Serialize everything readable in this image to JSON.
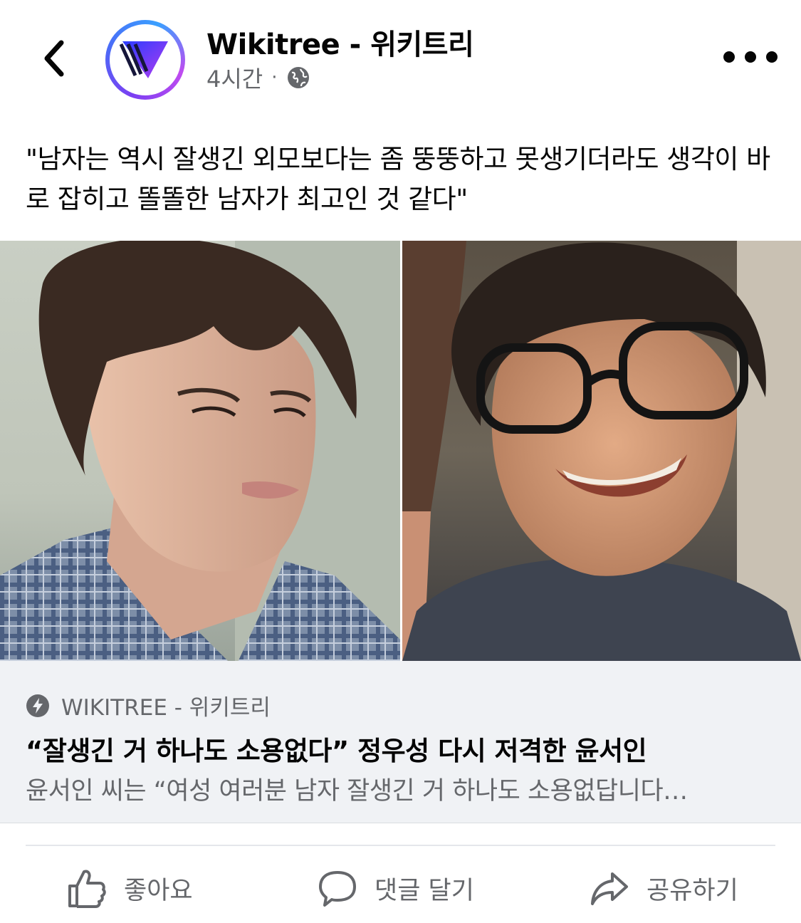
{
  "header": {
    "page_name": "Wikitree - 위키트리",
    "time": "4시간",
    "separator": "·",
    "icons": {
      "back": "chevron-left-icon",
      "privacy": "globe-icon",
      "more": "more-dots-icon"
    }
  },
  "post": {
    "caption": "\"남자는 역시 잘생긴 외모보다는 좀 뚱뚱하고 못생기더라도 생각이 바로 잡히고 똘똘한 남자가 최고인 것 같다\""
  },
  "link_card": {
    "source": "WIKITREE - 위키트리",
    "title": "“잘생긴 거 하나도 소용없다” 정우성 다시 저격한 윤서인",
    "description": "윤서인 씨는 “여성 여러분 남자 잘생긴 거 하나도 소용없답니다…"
  },
  "actions": {
    "like_label": "좋아요",
    "comment_label": "댓글 달기",
    "share_label": "공유하기"
  },
  "colors": {
    "text_primary": "#050505",
    "text_secondary": "#65676b",
    "card_background": "#f0f2f5",
    "avatar_ring_start": "#7b3ff2",
    "avatar_ring_end": "#3aa0ff"
  }
}
